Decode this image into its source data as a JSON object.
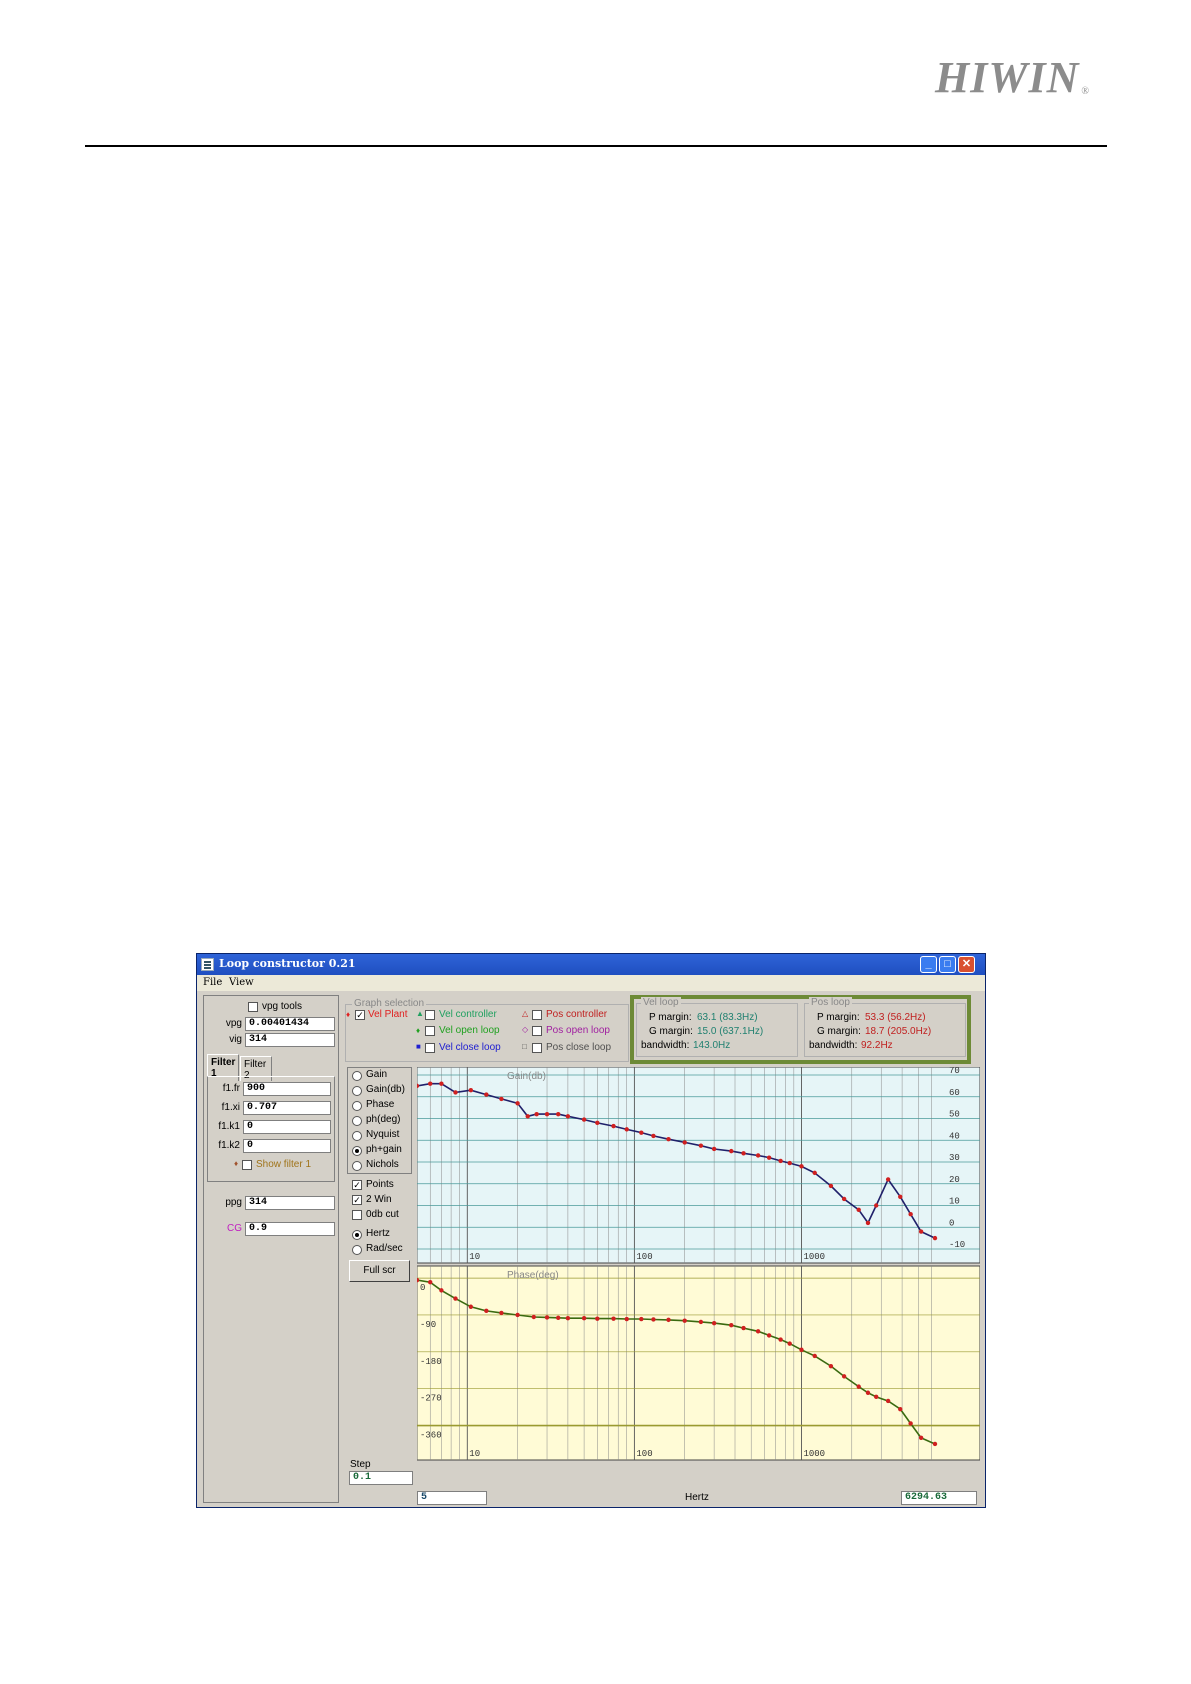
{
  "page": {
    "logo_text": "HIWIN"
  },
  "window": {
    "title": "Loop constructor 0.21",
    "menu": [
      "File",
      "View"
    ],
    "controls": {
      "minimize": "_",
      "maximize": "□",
      "close": "✕"
    }
  },
  "left_panel": {
    "vpg_tools_label": "vpg tools",
    "vpg_label": "vpg",
    "vpg_value": "0.00401434",
    "vig_label": "vig",
    "vig_value": "314",
    "tabs": [
      {
        "label_1": "Filter",
        "label_2": "1"
      },
      {
        "label_1": "Filter",
        "label_2": "2"
      }
    ],
    "filter_fields": [
      {
        "label": "f1.fr",
        "value": "900"
      },
      {
        "label": "f1.xi",
        "value": "0.707"
      },
      {
        "label": "f1.k1",
        "value": "0"
      },
      {
        "label": "f1.k2",
        "value": "0"
      }
    ],
    "show_filter_label": "Show filter 1",
    "ppg_label": "ppg",
    "ppg_value": "314",
    "cg_label": "CG",
    "cg_value": "0.9",
    "step_label": "Step",
    "step_value": "0.1"
  },
  "graph_selection": {
    "title": "Graph selection",
    "items": [
      {
        "label": "Vel Plant",
        "checked": true,
        "color": "#e02020",
        "marker": "♦"
      },
      {
        "label": "Vel controller",
        "checked": false,
        "color": "#20a060",
        "marker": "▲"
      },
      {
        "label": "Vel open loop",
        "checked": false,
        "color": "#20a020",
        "marker": "♦"
      },
      {
        "label": "Vel close loop",
        "checked": false,
        "color": "#2020d0",
        "marker": "■"
      },
      {
        "label": "Pos controller",
        "checked": false,
        "color": "#c02020",
        "marker": "△"
      },
      {
        "label": "Pos open loop",
        "checked": false,
        "color": "#a020a0",
        "marker": "◇"
      },
      {
        "label": "Pos close loop",
        "checked": false,
        "color": "#505050",
        "marker": "□"
      }
    ]
  },
  "margins": {
    "vel": {
      "title": "Vel loop",
      "p_label": "P margin:",
      "p_value": "63.1 (83.3Hz)",
      "g_label": "G margin:",
      "g_value": "15.0 (637.1Hz)",
      "bw_label": "bandwidth:",
      "bw_value": "143.0Hz",
      "color": "#208070"
    },
    "pos": {
      "title": "Pos loop",
      "p_label": "P margin:",
      "p_value": "53.3 (56.2Hz)",
      "g_label": "G margin:",
      "g_value": "18.7 (205.0Hz)",
      "bw_label": "bandwidth:",
      "bw_value": "92.2Hz",
      "color": "#c02020"
    }
  },
  "options": {
    "plot_modes": [
      {
        "label": "Gain",
        "selected": false
      },
      {
        "label": "Gain(db)",
        "selected": false
      },
      {
        "label": "Phase",
        "selected": false
      },
      {
        "label": "ph(deg)",
        "selected": false
      },
      {
        "label": "Nyquist",
        "selected": false
      },
      {
        "label": "ph+gain",
        "selected": true
      },
      {
        "label": "Nichols",
        "selected": false
      }
    ],
    "checks": [
      {
        "label": "Points",
        "checked": true
      },
      {
        "label": "2 Win",
        "checked": true
      },
      {
        "label": "0db cut",
        "checked": false
      }
    ],
    "units": [
      {
        "label": "Hertz",
        "selected": true
      },
      {
        "label": "Rad/sec",
        "selected": false
      }
    ],
    "full_screen_label": "Full scr"
  },
  "bottom_bar": {
    "left_value": "5",
    "center_label": "Hertz",
    "right_value": "6294.63"
  },
  "chart_data": [
    {
      "type": "line",
      "title": "Gain(db)",
      "x_scale": "log",
      "xlim": [
        5,
        6294.63
      ],
      "x_tick_labels": [
        "10",
        "100",
        "1000"
      ],
      "ylim": [
        -10,
        70
      ],
      "y_tick_labels": [
        "70",
        "60",
        "50",
        "40",
        "30",
        "20",
        "10",
        "0",
        "-10"
      ],
      "grid": true,
      "background": "#e6f5f7",
      "line_color": "#20206a",
      "point_color": "#d02020",
      "series": [
        {
          "x": [
            5,
            6,
            7,
            8.5,
            10.5,
            13,
            16,
            20,
            23,
            26,
            30,
            35,
            40,
            50,
            60,
            75,
            90,
            110,
            130,
            160,
            200,
            250,
            300,
            380,
            450,
            550,
            640,
            750,
            850,
            1000,
            1200,
            1500,
            1800,
            2200,
            2500,
            2800,
            3300,
            3900,
            4500,
            5200,
            6294.63
          ],
          "y": [
            65,
            66,
            66,
            62,
            63,
            61,
            59,
            57,
            51,
            52,
            52,
            52,
            51,
            49.5,
            48,
            46.5,
            45,
            43.5,
            42,
            40.5,
            39,
            37.5,
            36,
            35,
            34,
            33,
            32,
            30.5,
            29.5,
            28,
            25,
            19,
            13,
            8,
            2,
            10,
            22,
            14,
            6,
            -2,
            -5
          ]
        }
      ]
    },
    {
      "type": "line",
      "title": "Phase(deg)",
      "x_scale": "log",
      "xlim": [
        5,
        6294.63
      ],
      "x_tick_labels": [
        "10",
        "100",
        "1000"
      ],
      "ylim": [
        -410,
        10
      ],
      "y_tick_labels": [
        "0",
        "-90",
        "-180",
        "-270",
        "-360"
      ],
      "grid": true,
      "background": "#fffbd6",
      "line_color": "#3a6a10",
      "point_color": "#d02020",
      "series": [
        {
          "x": [
            5,
            6,
            7,
            8.5,
            10.5,
            13,
            16,
            20,
            25,
            30,
            35,
            40,
            50,
            60,
            75,
            90,
            110,
            130,
            160,
            200,
            250,
            300,
            380,
            450,
            550,
            640,
            750,
            850,
            1000,
            1200,
            1500,
            1800,
            2200,
            2500,
            2800,
            3300,
            3900,
            4500,
            5200,
            6294.63
          ],
          "y": [
            -5,
            -10,
            -30,
            -50,
            -70,
            -80,
            -85,
            -90,
            -95,
            -96,
            -97,
            -98,
            -98,
            -99,
            -99,
            -100,
            -100,
            -101,
            -102,
            -104,
            -107,
            -110,
            -115,
            -122,
            -130,
            -140,
            -150,
            -160,
            -175,
            -190,
            -215,
            -240,
            -265,
            -280,
            -290,
            -300,
            -320,
            -355,
            -390,
            -405
          ]
        }
      ]
    }
  ]
}
